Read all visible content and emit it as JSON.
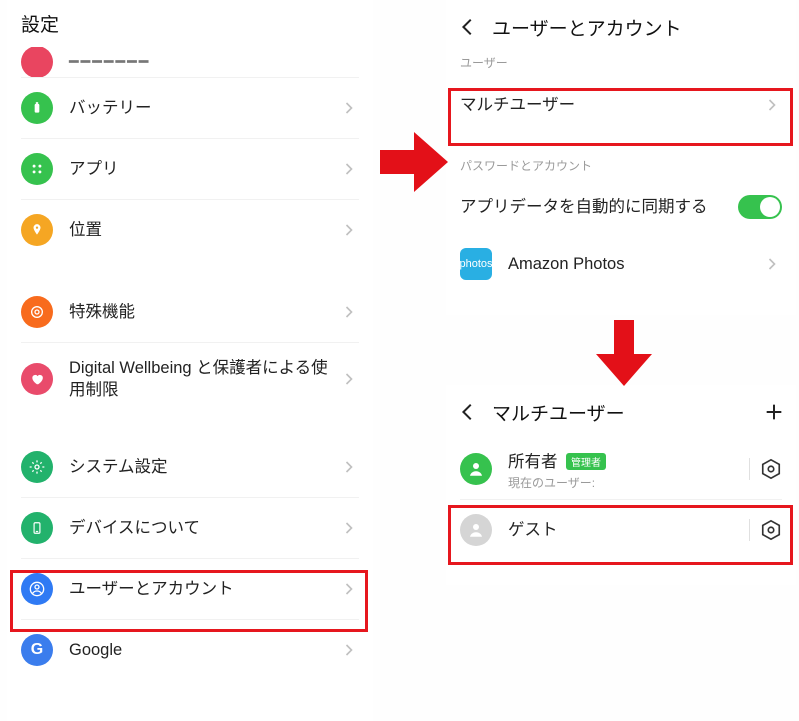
{
  "left": {
    "title": "設定",
    "items": [
      {
        "id": "battery",
        "label": "バッテリー",
        "iconColor": "#36c24e",
        "glyph": "battery"
      },
      {
        "id": "apps",
        "label": "アプリ",
        "iconColor": "#36c24e",
        "glyph": "grid4"
      },
      {
        "id": "location",
        "label": "位置",
        "iconColor": "#f5a623",
        "glyph": "pin"
      },
      {
        "id": "special",
        "label": "特殊機能",
        "iconColor": "#f86b1d",
        "glyph": "star-gear"
      },
      {
        "id": "wellbeing",
        "label": "Digital Wellbeing と保護者による使用制限",
        "iconColor": "#e94b6b",
        "glyph": "heart"
      },
      {
        "id": "system",
        "label": "システム設定",
        "iconColor": "#22b26c",
        "glyph": "cog"
      },
      {
        "id": "device",
        "label": "デバイスについて",
        "iconColor": "#22b26c",
        "glyph": "phone"
      },
      {
        "id": "users",
        "label": "ユーザーとアカウント",
        "iconColor": "#2f7af4",
        "glyph": "user-ring"
      },
      {
        "id": "google",
        "label": "Google",
        "iconColor": "#3b7ded",
        "glyph": "G"
      }
    ]
  },
  "tr": {
    "title": "ユーザーとアカウント",
    "section_user": "ユーザー",
    "multiuser": "マルチユーザー",
    "section_pwacct": "パスワードとアカウント",
    "sync_label": "アプリデータを自動的に同期する",
    "sync_on": true,
    "photos_label": "Amazon Photos",
    "photos_icon_text": "photos",
    "photos_icon_bg": "#29afe3"
  },
  "br": {
    "title": "マルチユーザー",
    "owner": "所有者",
    "owner_badge": "管理者",
    "owner_sub": "現在のユーザー:",
    "guest": "ゲスト"
  },
  "colors": {
    "highlight": "#e6171e",
    "arrow": "#e31018"
  }
}
